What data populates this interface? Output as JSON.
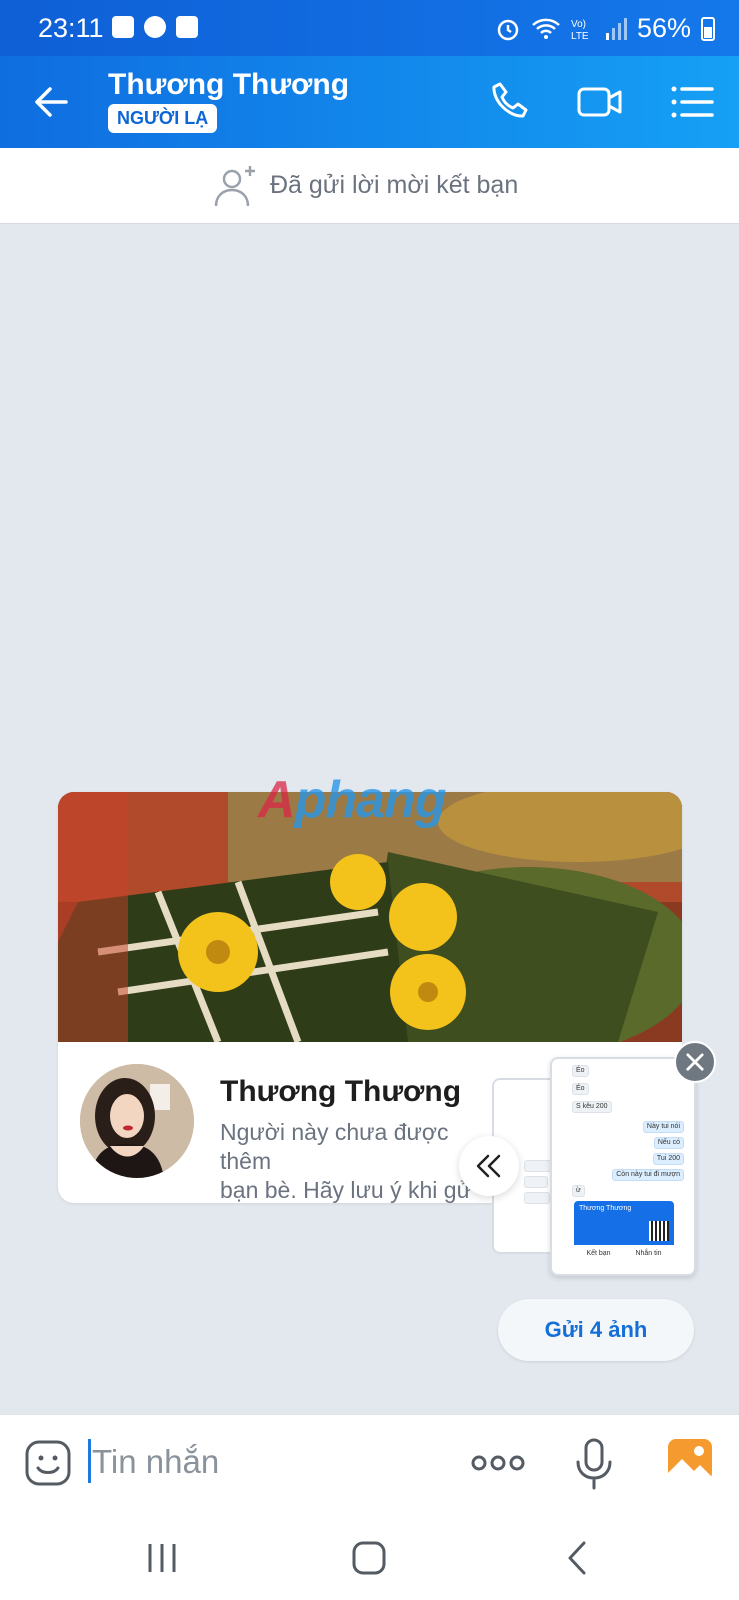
{
  "status_bar": {
    "time": "23:11",
    "battery": "56%",
    "icons": [
      "gallery-icon",
      "messenger-icon",
      "check-icon",
      "alarm-icon",
      "wifi-icon",
      "volte-icon",
      "signal-icon",
      "battery-icon"
    ]
  },
  "header": {
    "contact_name": "Thương Thương",
    "badge": "NGƯỜI LẠ"
  },
  "friend_request": {
    "text": "Đã gửi lời mời kết bạn"
  },
  "watermark": {
    "part1": "A",
    "part2": "phang"
  },
  "profile_card": {
    "name": "Thương Thương",
    "description": "Người này chưa được thêm\nbạn bè. Hãy lưu ý khi gử"
  },
  "thumbnail": {
    "messages": [
      "Éo",
      "Éo",
      "S kêu 200",
      "Này tui nói",
      "Nếu có",
      "Tui 200",
      "Còn này tui đi mượn",
      "ừ"
    ],
    "card_name": "Thương Thương",
    "card_actions": [
      "Kết bạn",
      "Nhắn tin"
    ]
  },
  "send_button": {
    "label": "Gửi 4 ảnh"
  },
  "composer": {
    "placeholder": "Tin nhắn"
  },
  "colors": {
    "header_start": "#0f6de0",
    "header_end": "#15a0f5",
    "chat_bg": "#e3e8ef",
    "accent": "#1470d8"
  }
}
